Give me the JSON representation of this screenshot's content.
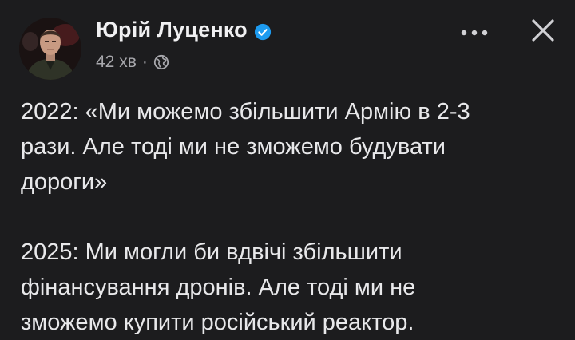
{
  "post": {
    "author": "Юрій Луценко",
    "timestamp": "42 хв",
    "separator": "·",
    "visibility_icon": "globe-icon",
    "verified_icon": "verified-badge-icon",
    "more_icon": "more-horizontal-icon",
    "close_icon": "close-icon",
    "paragraphs": [
      {
        "lines": [
          "2022: «Ми можемо збільшити Армію в 2-3",
          "рази. Але тоді ми не зможемо будувати",
          "дороги»"
        ]
      },
      {
        "lines": [
          "2025: Ми могли би вдвічі збільшити",
          "фінансування дронів. Але тоді ми не",
          "зможемо купити російський реактор."
        ]
      }
    ]
  },
  "colors": {
    "background": "#1c1c1e",
    "text": "#e8e8ea",
    "muted": "#a8a8ad",
    "verified": "#1d9bf0"
  }
}
